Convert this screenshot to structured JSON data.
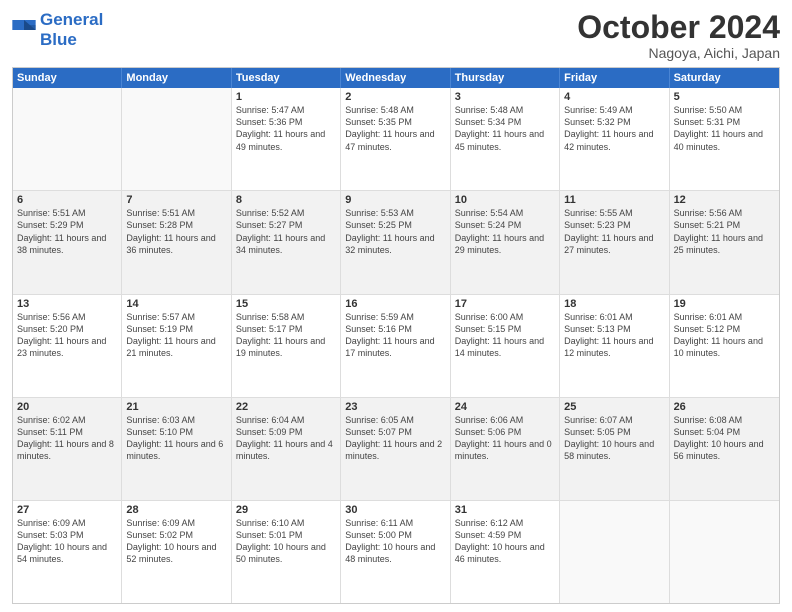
{
  "logo": {
    "line1": "General",
    "line2": "Blue"
  },
  "title": "October 2024",
  "location": "Nagoya, Aichi, Japan",
  "days_header": [
    "Sunday",
    "Monday",
    "Tuesday",
    "Wednesday",
    "Thursday",
    "Friday",
    "Saturday"
  ],
  "weeks": [
    [
      {
        "day": "",
        "info": ""
      },
      {
        "day": "",
        "info": ""
      },
      {
        "day": "1",
        "info": "Sunrise: 5:47 AM\nSunset: 5:36 PM\nDaylight: 11 hours and 49 minutes."
      },
      {
        "day": "2",
        "info": "Sunrise: 5:48 AM\nSunset: 5:35 PM\nDaylight: 11 hours and 47 minutes."
      },
      {
        "day": "3",
        "info": "Sunrise: 5:48 AM\nSunset: 5:34 PM\nDaylight: 11 hours and 45 minutes."
      },
      {
        "day": "4",
        "info": "Sunrise: 5:49 AM\nSunset: 5:32 PM\nDaylight: 11 hours and 42 minutes."
      },
      {
        "day": "5",
        "info": "Sunrise: 5:50 AM\nSunset: 5:31 PM\nDaylight: 11 hours and 40 minutes."
      }
    ],
    [
      {
        "day": "6",
        "info": "Sunrise: 5:51 AM\nSunset: 5:29 PM\nDaylight: 11 hours and 38 minutes."
      },
      {
        "day": "7",
        "info": "Sunrise: 5:51 AM\nSunset: 5:28 PM\nDaylight: 11 hours and 36 minutes."
      },
      {
        "day": "8",
        "info": "Sunrise: 5:52 AM\nSunset: 5:27 PM\nDaylight: 11 hours and 34 minutes."
      },
      {
        "day": "9",
        "info": "Sunrise: 5:53 AM\nSunset: 5:25 PM\nDaylight: 11 hours and 32 minutes."
      },
      {
        "day": "10",
        "info": "Sunrise: 5:54 AM\nSunset: 5:24 PM\nDaylight: 11 hours and 29 minutes."
      },
      {
        "day": "11",
        "info": "Sunrise: 5:55 AM\nSunset: 5:23 PM\nDaylight: 11 hours and 27 minutes."
      },
      {
        "day": "12",
        "info": "Sunrise: 5:56 AM\nSunset: 5:21 PM\nDaylight: 11 hours and 25 minutes."
      }
    ],
    [
      {
        "day": "13",
        "info": "Sunrise: 5:56 AM\nSunset: 5:20 PM\nDaylight: 11 hours and 23 minutes."
      },
      {
        "day": "14",
        "info": "Sunrise: 5:57 AM\nSunset: 5:19 PM\nDaylight: 11 hours and 21 minutes."
      },
      {
        "day": "15",
        "info": "Sunrise: 5:58 AM\nSunset: 5:17 PM\nDaylight: 11 hours and 19 minutes."
      },
      {
        "day": "16",
        "info": "Sunrise: 5:59 AM\nSunset: 5:16 PM\nDaylight: 11 hours and 17 minutes."
      },
      {
        "day": "17",
        "info": "Sunrise: 6:00 AM\nSunset: 5:15 PM\nDaylight: 11 hours and 14 minutes."
      },
      {
        "day": "18",
        "info": "Sunrise: 6:01 AM\nSunset: 5:13 PM\nDaylight: 11 hours and 12 minutes."
      },
      {
        "day": "19",
        "info": "Sunrise: 6:01 AM\nSunset: 5:12 PM\nDaylight: 11 hours and 10 minutes."
      }
    ],
    [
      {
        "day": "20",
        "info": "Sunrise: 6:02 AM\nSunset: 5:11 PM\nDaylight: 11 hours and 8 minutes."
      },
      {
        "day": "21",
        "info": "Sunrise: 6:03 AM\nSunset: 5:10 PM\nDaylight: 11 hours and 6 minutes."
      },
      {
        "day": "22",
        "info": "Sunrise: 6:04 AM\nSunset: 5:09 PM\nDaylight: 11 hours and 4 minutes."
      },
      {
        "day": "23",
        "info": "Sunrise: 6:05 AM\nSunset: 5:07 PM\nDaylight: 11 hours and 2 minutes."
      },
      {
        "day": "24",
        "info": "Sunrise: 6:06 AM\nSunset: 5:06 PM\nDaylight: 11 hours and 0 minutes."
      },
      {
        "day": "25",
        "info": "Sunrise: 6:07 AM\nSunset: 5:05 PM\nDaylight: 10 hours and 58 minutes."
      },
      {
        "day": "26",
        "info": "Sunrise: 6:08 AM\nSunset: 5:04 PM\nDaylight: 10 hours and 56 minutes."
      }
    ],
    [
      {
        "day": "27",
        "info": "Sunrise: 6:09 AM\nSunset: 5:03 PM\nDaylight: 10 hours and 54 minutes."
      },
      {
        "day": "28",
        "info": "Sunrise: 6:09 AM\nSunset: 5:02 PM\nDaylight: 10 hours and 52 minutes."
      },
      {
        "day": "29",
        "info": "Sunrise: 6:10 AM\nSunset: 5:01 PM\nDaylight: 10 hours and 50 minutes."
      },
      {
        "day": "30",
        "info": "Sunrise: 6:11 AM\nSunset: 5:00 PM\nDaylight: 10 hours and 48 minutes."
      },
      {
        "day": "31",
        "info": "Sunrise: 6:12 AM\nSunset: 4:59 PM\nDaylight: 10 hours and 46 minutes."
      },
      {
        "day": "",
        "info": ""
      },
      {
        "day": "",
        "info": ""
      }
    ]
  ]
}
